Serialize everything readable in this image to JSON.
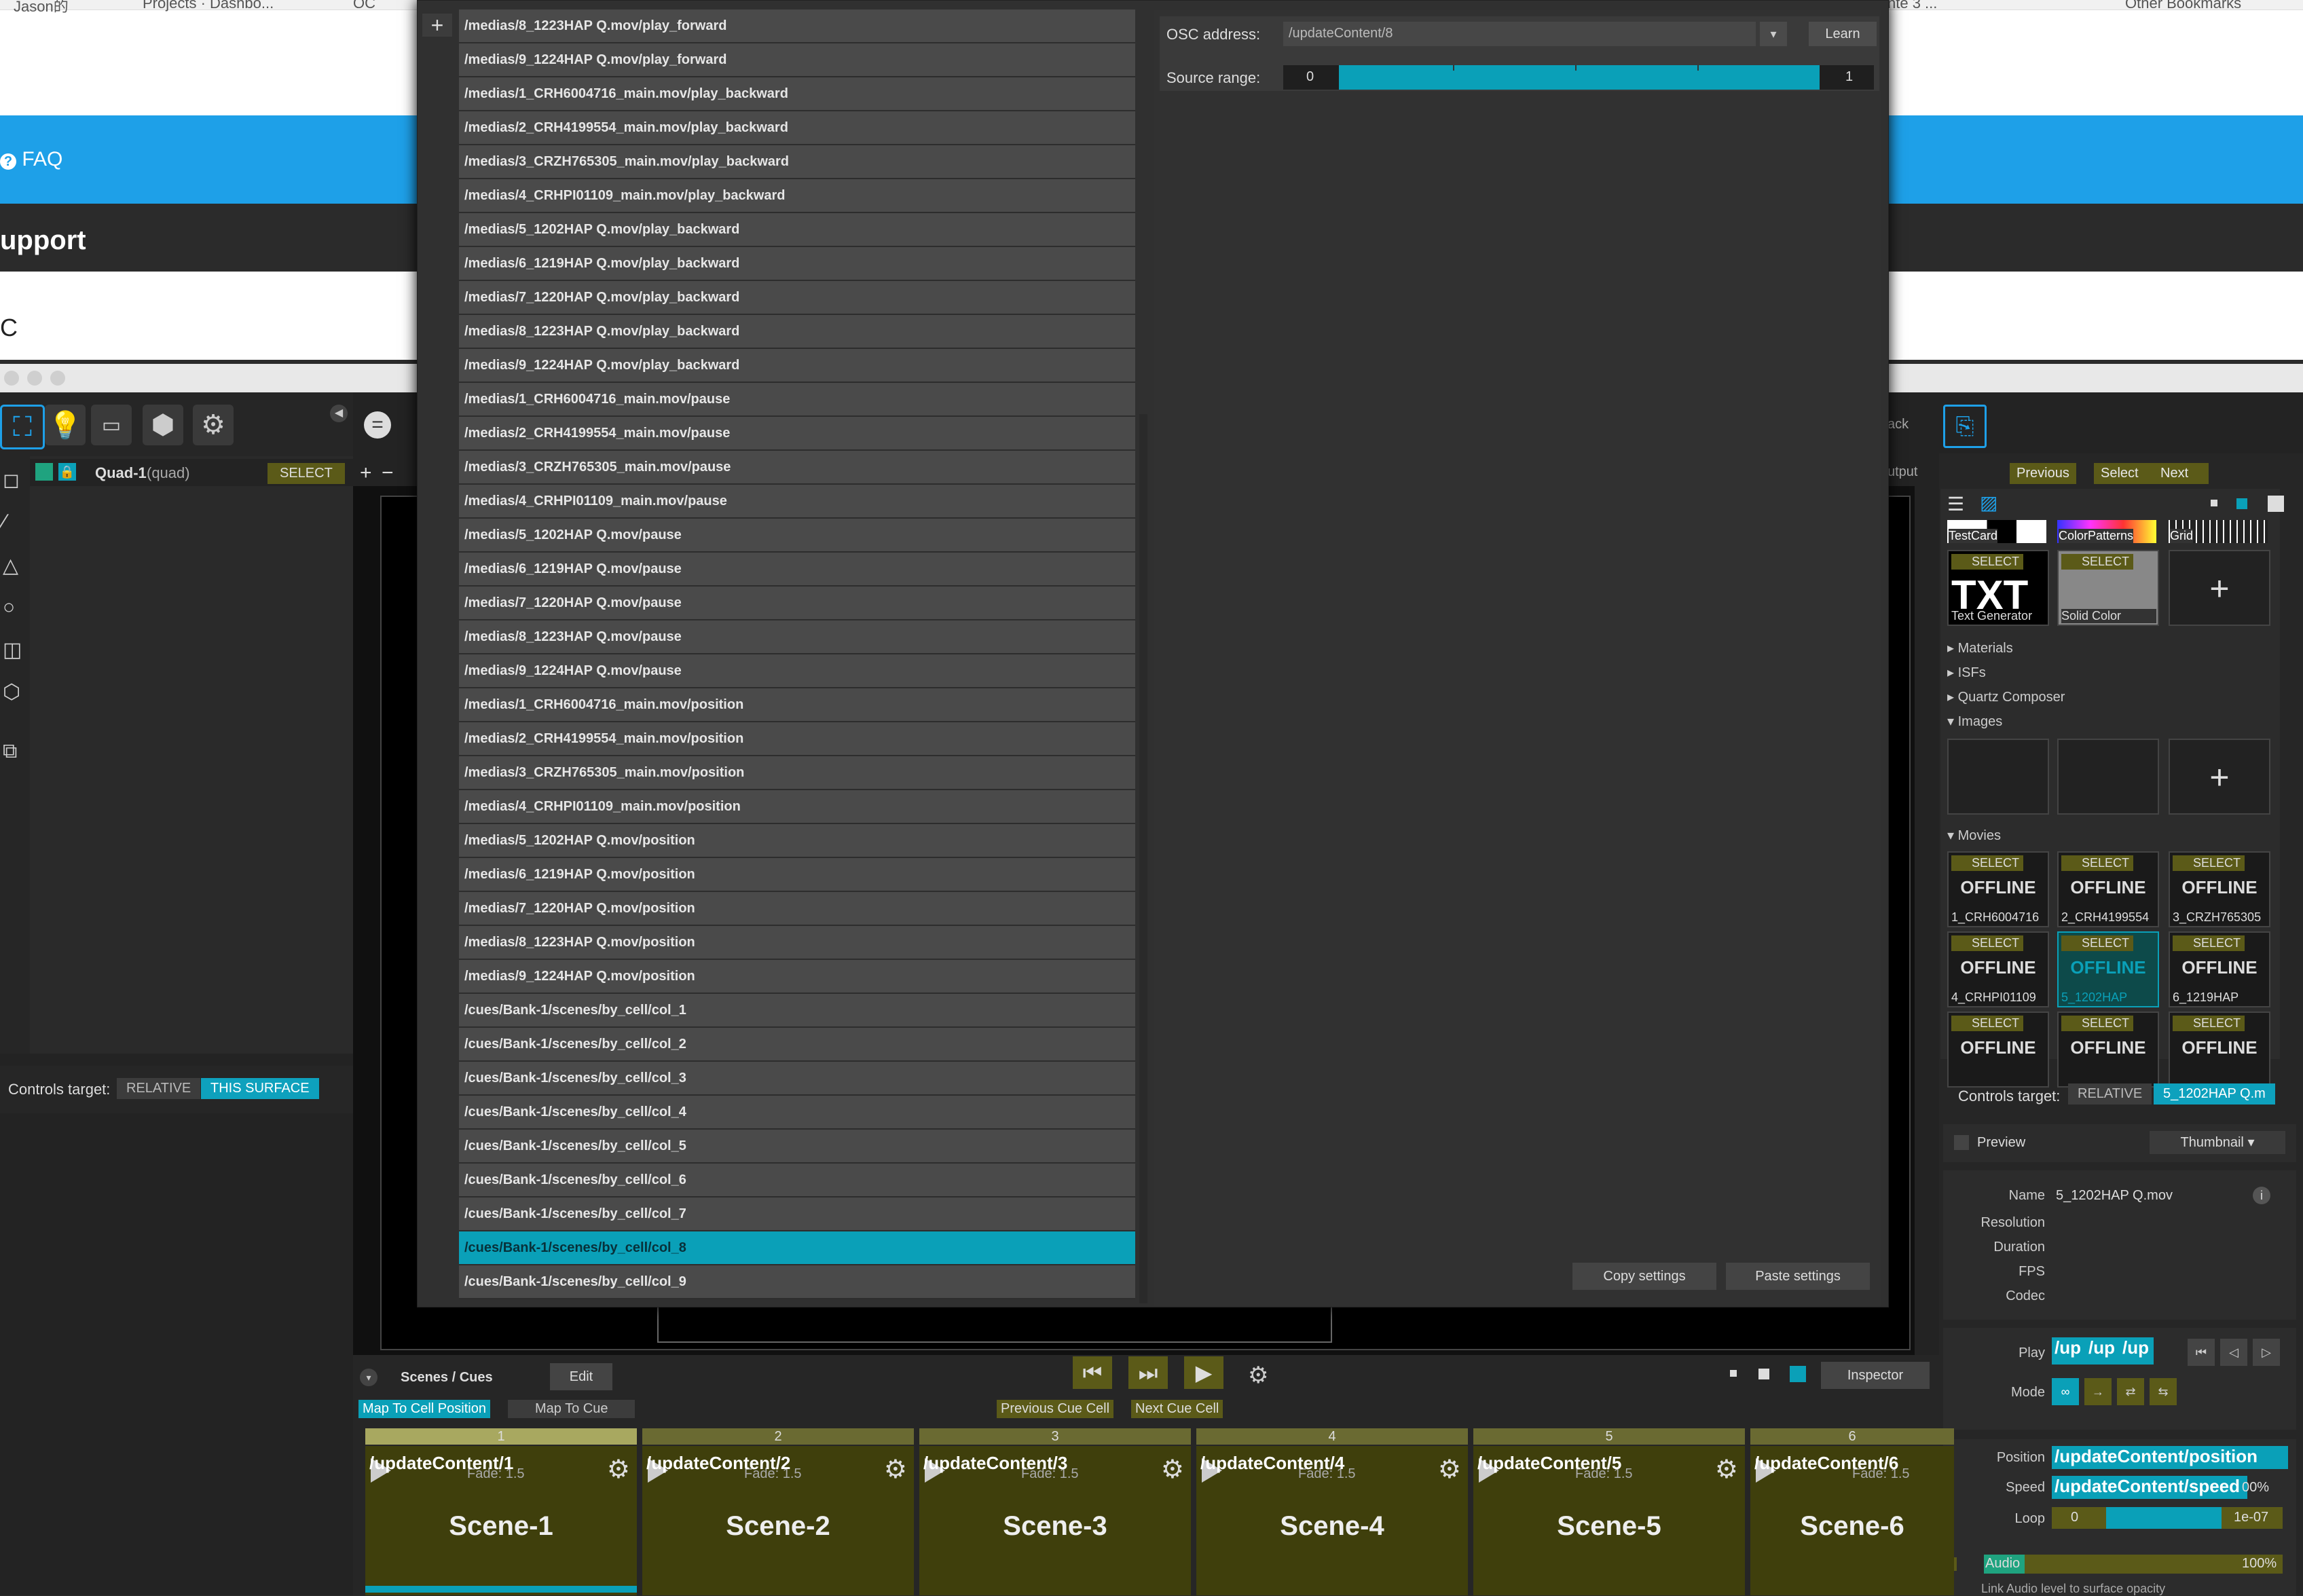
{
  "browser": {
    "bookmarks": [
      "Jason的",
      "Projects · Dashbo...",
      "OC",
      "nte 3 ...",
      "Other Bookmarks"
    ],
    "faq": "FAQ",
    "support": "upport",
    "c_letter": "C"
  },
  "left": {
    "quad_name": "Quad-1",
    "quad_type": "(quad)",
    "select": "SELECT",
    "controls_target_label": "Controls target:",
    "relative": "RELATIVE",
    "this_surface": "THIS SURFACE"
  },
  "modal": {
    "plus": "+",
    "osc_items": [
      "/medias/8_1223HAP Q.mov/play_forward",
      "/medias/9_1224HAP Q.mov/play_forward",
      "/medias/1_CRH6004716_main.mov/play_backward",
      "/medias/2_CRH4199554_main.mov/play_backward",
      "/medias/3_CRZH765305_main.mov/play_backward",
      "/medias/4_CRHPI01109_main.mov/play_backward",
      "/medias/5_1202HAP Q.mov/play_backward",
      "/medias/6_1219HAP Q.mov/play_backward",
      "/medias/7_1220HAP Q.mov/play_backward",
      "/medias/8_1223HAP Q.mov/play_backward",
      "/medias/9_1224HAP Q.mov/play_backward",
      "/medias/1_CRH6004716_main.mov/pause",
      "/medias/2_CRH4199554_main.mov/pause",
      "/medias/3_CRZH765305_main.mov/pause",
      "/medias/4_CRHPI01109_main.mov/pause",
      "/medias/5_1202HAP Q.mov/pause",
      "/medias/6_1219HAP Q.mov/pause",
      "/medias/7_1220HAP Q.mov/pause",
      "/medias/8_1223HAP Q.mov/pause",
      "/medias/9_1224HAP Q.mov/pause",
      "/medias/1_CRH6004716_main.mov/position",
      "/medias/2_CRH4199554_main.mov/position",
      "/medias/3_CRZH765305_main.mov/position",
      "/medias/4_CRHPI01109_main.mov/position",
      "/medias/5_1202HAP Q.mov/position",
      "/medias/6_1219HAP Q.mov/position",
      "/medias/7_1220HAP Q.mov/position",
      "/medias/8_1223HAP Q.mov/position",
      "/medias/9_1224HAP Q.mov/position",
      "/cues/Bank-1/scenes/by_cell/col_1",
      "/cues/Bank-1/scenes/by_cell/col_2",
      "/cues/Bank-1/scenes/by_cell/col_3",
      "/cues/Bank-1/scenes/by_cell/col_4",
      "/cues/Bank-1/scenes/by_cell/col_5",
      "/cues/Bank-1/scenes/by_cell/col_6",
      "/cues/Bank-1/scenes/by_cell/col_7",
      "/cues/Bank-1/scenes/by_cell/col_8",
      "/cues/Bank-1/scenes/by_cell/col_9"
    ],
    "selected_index": 36,
    "osc_address_label": "OSC address:",
    "osc_address_value": "/updateContent/8",
    "learn": "Learn",
    "source_range_label": "Source range:",
    "range_min": "0",
    "range_max": "1",
    "copy_settings": "Copy settings",
    "paste_settings": "Paste settings"
  },
  "right": {
    "ack": "ack",
    "utput": "utput",
    "previous": "Previous",
    "select": "Select",
    "next": "Next",
    "gen_thumbs": [
      "TestCard",
      "ColorPatterns",
      "Grid"
    ],
    "txt": "TXT",
    "text_generator": "Text Generator",
    "solid_color": "Solid Color",
    "select_label": "SELECT",
    "plus": "+",
    "sections": [
      "Materials",
      "ISFs",
      "Quartz Composer",
      "Images",
      "Movies"
    ],
    "offline": "OFFLINE",
    "movies": [
      "1_CRH6004716",
      "2_CRH4199554",
      "3_CRZH765305",
      "4_CRHPI01109",
      "5_1202HAP",
      "6_1219HAP",
      "",
      "",
      ""
    ],
    "controls_target_label": "Controls target:",
    "relative": "RELATIVE",
    "target_value": "5_1202HAP Q.m",
    "preview": "Preview",
    "thumbnail": "Thumbnail",
    "name_label": "Name",
    "name_value": "5_1202HAP Q.mov",
    "resolution_label": "Resolution",
    "duration_label": "Duration",
    "fps_label": "FPS",
    "codec_label": "Codec",
    "play_label": "Play",
    "play_fields": [
      "/up",
      "/up",
      "/up"
    ],
    "mode_label": "Mode",
    "position_label": "Position",
    "position_value": "/updateContent/position",
    "speed_label": "Speed",
    "speed_value": "/updateContent/speed",
    "speed_pct": "00%",
    "loop_label": "Loop",
    "loop_min": "0",
    "loop_max": "1e-07",
    "audio_label": "Audio",
    "audio_pct": "100%",
    "link_audio": "Link Audio level to surface opacity"
  },
  "bottom": {
    "scenes_cues": "Scenes / Cues",
    "edit": "Edit",
    "inspector": "Inspector",
    "map_to_cell": "Map To Cell Position",
    "map_to_cue": "Map To Cue",
    "prev_cue_cell": "Previous Cue Cell",
    "next_cue_cell": "Next Cue Cell",
    "fade_label": "Fade: 1.5",
    "cells": [
      {
        "num": "1",
        "addr": "/updateContent/1",
        "name": "Scene-1"
      },
      {
        "num": "2",
        "addr": "/updateContent/2",
        "name": "Scene-2"
      },
      {
        "num": "3",
        "addr": "/updateContent/3",
        "name": "Scene-3"
      },
      {
        "num": "4",
        "addr": "/updateContent/4",
        "name": "Scene-4"
      },
      {
        "num": "5",
        "addr": "/updateContent/5",
        "name": "Scene-5"
      },
      {
        "num": "6",
        "addr": "/updateContent/6",
        "name": "Scene-6"
      }
    ]
  }
}
